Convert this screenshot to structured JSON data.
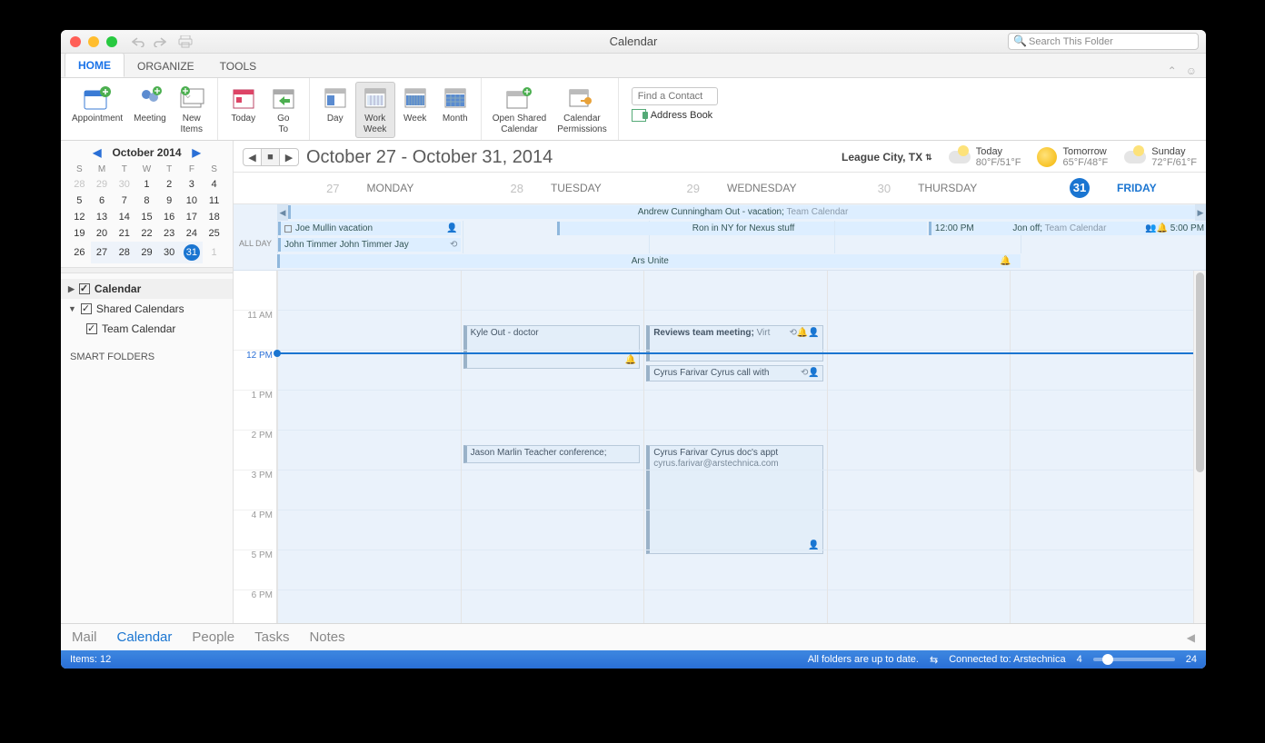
{
  "window": {
    "title": "Calendar",
    "search_placeholder": "Search This Folder"
  },
  "tabs": {
    "home": "HOME",
    "organize": "ORGANIZE",
    "tools": "TOOLS"
  },
  "ribbon": {
    "appointment": "Appointment",
    "meeting": "Meeting",
    "new_items": "New\nItems",
    "today": "Today",
    "go_to": "Go\nTo",
    "day": "Day",
    "work_week": "Work\nWeek",
    "week": "Week",
    "month": "Month",
    "open_shared": "Open Shared\nCalendar",
    "cal_perm": "Calendar\nPermissions",
    "find_contact_placeholder": "Find a Contact",
    "address_book": "Address Book"
  },
  "mini": {
    "title": "October 2014",
    "dow": [
      "S",
      "M",
      "T",
      "W",
      "T",
      "F",
      "S"
    ],
    "rows": [
      [
        {
          "n": "28",
          "d": 1
        },
        {
          "n": "29",
          "d": 1
        },
        {
          "n": "30",
          "d": 1
        },
        {
          "n": "1"
        },
        {
          "n": "2"
        },
        {
          "n": "3"
        },
        {
          "n": "4"
        }
      ],
      [
        {
          "n": "5"
        },
        {
          "n": "6"
        },
        {
          "n": "7"
        },
        {
          "n": "8"
        },
        {
          "n": "9"
        },
        {
          "n": "10"
        },
        {
          "n": "11"
        }
      ],
      [
        {
          "n": "12"
        },
        {
          "n": "13"
        },
        {
          "n": "14"
        },
        {
          "n": "15"
        },
        {
          "n": "16"
        },
        {
          "n": "17"
        },
        {
          "n": "18"
        }
      ],
      [
        {
          "n": "19"
        },
        {
          "n": "20"
        },
        {
          "n": "21"
        },
        {
          "n": "22"
        },
        {
          "n": "23"
        },
        {
          "n": "24"
        },
        {
          "n": "25"
        }
      ],
      [
        {
          "n": "26"
        },
        {
          "n": "27",
          "r": 1
        },
        {
          "n": "28",
          "r": 1
        },
        {
          "n": "29",
          "r": 1
        },
        {
          "n": "30",
          "r": 1
        },
        {
          "n": "31",
          "r": 1,
          "s": 1
        },
        {
          "n": "1",
          "d": 1
        }
      ]
    ]
  },
  "sidecal": {
    "calendar": "Calendar",
    "shared": "Shared Calendars",
    "team": "Team Calendar",
    "smart": "SMART FOLDERS"
  },
  "header": {
    "range": "October 27 - October 31, 2014",
    "location": "League City, TX",
    "w0_day": "Today",
    "w0_temp": "80°F/51°F",
    "w1_day": "Tomorrow",
    "w1_temp": "65°F/48°F",
    "w2_day": "Sunday",
    "w2_temp": "72°F/61°F"
  },
  "days": [
    {
      "num": "27",
      "name": "MONDAY"
    },
    {
      "num": "28",
      "name": "TUESDAY"
    },
    {
      "num": "29",
      "name": "WEDNESDAY"
    },
    {
      "num": "30",
      "name": "THURSDAY"
    },
    {
      "num": "31",
      "name": "FRIDAY"
    }
  ],
  "allday": {
    "label": "ALL DAY",
    "r0": "Andrew Cunningham Out - vacation;",
    "r0_cal": " Team Calendar",
    "r1a": "Joe Mullin vacation",
    "r1b": "Ron in NY for Nexus stuff",
    "r1c_time": "12:00 PM",
    "r1c": "Jon off; ",
    "r1c_cal": "Team Calendar",
    "r1c_end": "5:00 PM",
    "r2": "John Timmer John Timmer Jay",
    "r3": "Ars Unite"
  },
  "times": [
    "",
    "11 AM",
    "12 PM",
    "1 PM",
    "2 PM",
    "3 PM",
    "4 PM",
    "5 PM",
    "6 PM"
  ],
  "events": {
    "kyle": "Kyle Out - doctor",
    "reviews": "Reviews team meeting; ",
    "reviews_sub": "Virt",
    "cyrus_call": "Cyrus Farivar Cyrus call with",
    "jason": "Jason Marlin Teacher conference;",
    "cyrus_doc": "Cyrus Farivar Cyrus doc's appt",
    "cyrus_email": "cyrus.farivar@arstechnica.com"
  },
  "bottom": {
    "mail": "Mail",
    "calendar": "Calendar",
    "people": "People",
    "tasks": "Tasks",
    "notes": "Notes"
  },
  "status": {
    "items": "Items: 12",
    "sync": "All folders are up to date.",
    "conn": "Connected to: Arstechnica",
    "zmin": "4",
    "zmax": "24"
  }
}
